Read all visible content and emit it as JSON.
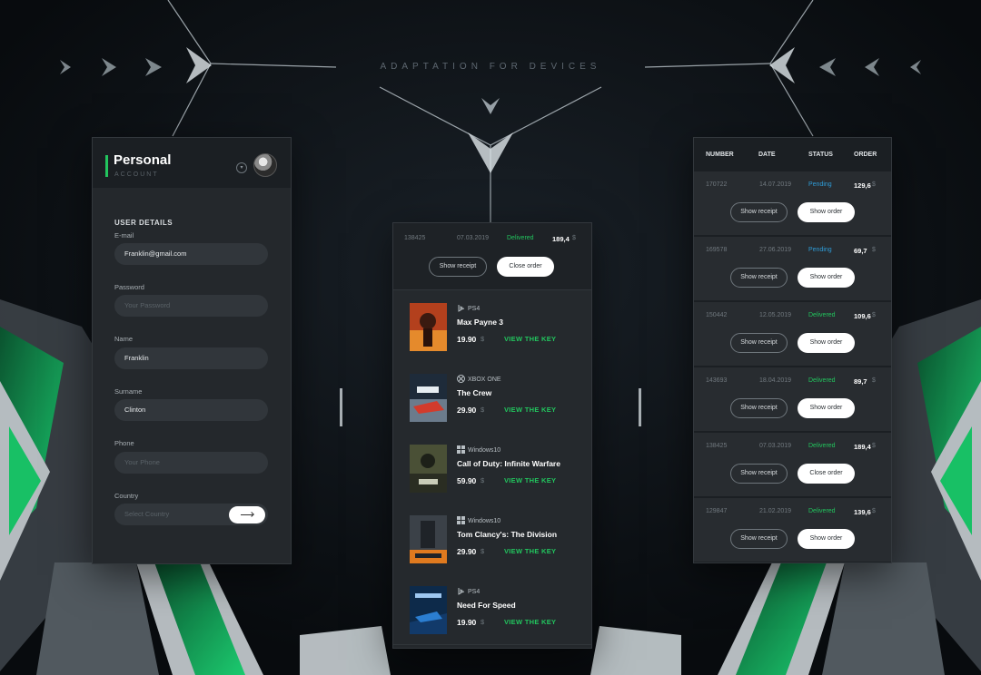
{
  "headline": "ADAPTATION FOR DEVICES",
  "colors": {
    "accent": "#22c55e",
    "pending": "#2f9bd6",
    "background": "#0d1216",
    "panel": "#24282c"
  },
  "personal": {
    "title": "Personal",
    "subtitle": "ACCOUNT",
    "download_icon": "download-icon",
    "section": "USER DETAILS",
    "fields": [
      {
        "label": "E-mail",
        "value": "Franklin@gmail.com",
        "placeholder": ""
      },
      {
        "label": "Password",
        "value": "",
        "placeholder": "Your Password"
      },
      {
        "label": "Name",
        "value": "Franklin",
        "placeholder": ""
      },
      {
        "label": "Surname",
        "value": "Clinton",
        "placeholder": ""
      },
      {
        "label": "Phone",
        "value": "",
        "placeholder": "Your Phone"
      },
      {
        "label": "Country",
        "value": "",
        "placeholder": "Select Country"
      }
    ],
    "submit_icon": "arrow-right-icon"
  },
  "order_detail": {
    "number": "138425",
    "date": "07.03.2019",
    "status": "Delivered",
    "amount": "189,4",
    "currency": "$",
    "show_receipt": "Show receipt",
    "close_order": "Close order",
    "games": [
      {
        "platform": "PS4",
        "platform_icon": "playstation-icon",
        "title": "Max Payne 3",
        "price": "19.90",
        "currency": "$",
        "action": "VIEW THE KEY"
      },
      {
        "platform": "XBOX ONE",
        "platform_icon": "xbox-icon",
        "title": "The Crew",
        "price": "29.90",
        "currency": "$",
        "action": "VIEW THE KEY"
      },
      {
        "platform": "Windows10",
        "platform_icon": "windows-icon",
        "title": "Call of Duty: Infinite Warfare",
        "price": "59.90",
        "currency": "$",
        "action": "VIEW THE KEY"
      },
      {
        "platform": "Windows10",
        "platform_icon": "windows-icon",
        "title": "Tom Clancy's: The Division",
        "price": "29.90",
        "currency": "$",
        "action": "VIEW THE KEY"
      },
      {
        "platform": "PS4",
        "platform_icon": "playstation-icon",
        "title": "Need For Speed",
        "price": "19.90",
        "currency": "$",
        "action": "VIEW THE KEY"
      }
    ]
  },
  "orders": {
    "columns": [
      "NUMBER",
      "DATE",
      "STATUS",
      "ORDER"
    ],
    "rows": [
      {
        "number": "170722",
        "date": "14.07.2019",
        "status": "Pending",
        "amount": "129,6",
        "currency": "$",
        "receipt": "Show receipt",
        "action": "Show order"
      },
      {
        "number": "169578",
        "date": "27.06.2019",
        "status": "Pending",
        "amount": "69,7",
        "currency": "$",
        "receipt": "Show receipt",
        "action": "Show order"
      },
      {
        "number": "150442",
        "date": "12.05.2019",
        "status": "Delivered",
        "amount": "109,6",
        "currency": "$",
        "receipt": "Show receipt",
        "action": "Show order"
      },
      {
        "number": "143693",
        "date": "18.04.2019",
        "status": "Delivered",
        "amount": "89,7",
        "currency": "$",
        "receipt": "Show receipt",
        "action": "Show order"
      },
      {
        "number": "138425",
        "date": "07.03.2019",
        "status": "Delivered",
        "amount": "189,4",
        "currency": "$",
        "receipt": "Show receipt",
        "action": "Close order"
      },
      {
        "number": "129847",
        "date": "21.02.2019",
        "status": "Delivered",
        "amount": "139,6",
        "currency": "$",
        "receipt": "Show receipt",
        "action": "Show order"
      }
    ]
  }
}
